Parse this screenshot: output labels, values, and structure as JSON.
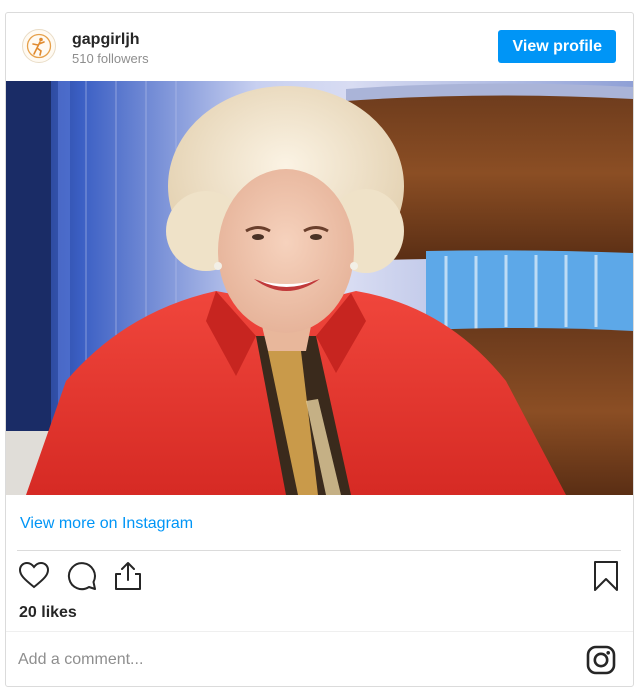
{
  "header": {
    "username": "gapgirljh",
    "followers": "510 followers",
    "view_profile_label": "View profile",
    "avatar_icon": "figure-logo-icon"
  },
  "post": {
    "image_alt": "photo",
    "view_more_label": "View more on Instagram",
    "likes": "20 likes",
    "comment_placeholder": "Add a comment..."
  },
  "icons": {
    "like": "heart-icon",
    "comment": "comment-icon",
    "share": "share-icon",
    "save": "bookmark-icon",
    "brand": "instagram-icon"
  },
  "colors": {
    "accent": "#0095f6",
    "jacket": "#e0302a",
    "border": "#dbdbdb"
  }
}
